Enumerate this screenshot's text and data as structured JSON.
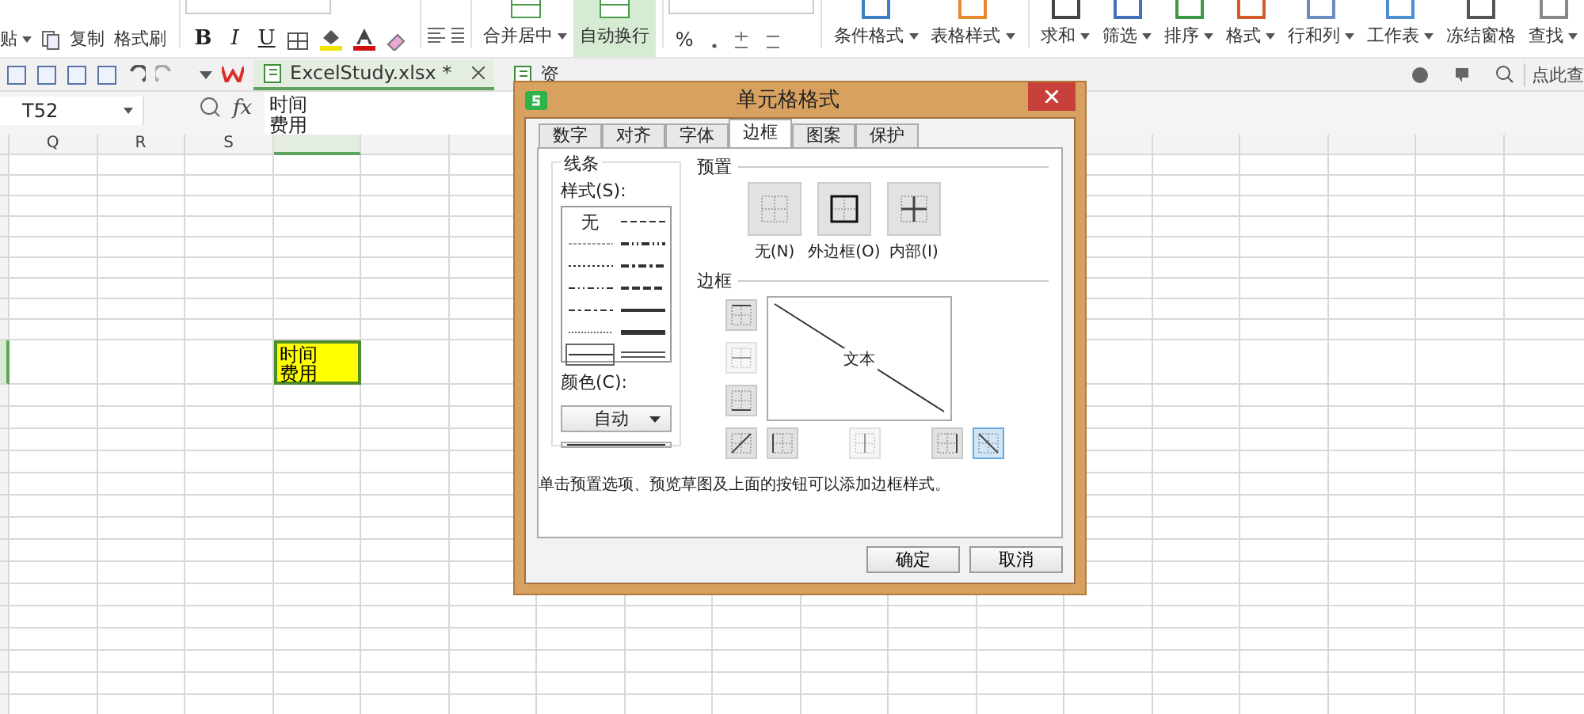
{
  "ribbon": {
    "clipboard": [
      {
        "label": "贴",
        "menu": true
      },
      {
        "label": "复制",
        "menu": false
      },
      {
        "label": "格式刷",
        "menu": false
      }
    ],
    "font_styles": [
      "B",
      "I",
      "U"
    ],
    "alignment": [
      {
        "label": "合并居中",
        "menu": true,
        "on": false
      },
      {
        "label": "自动换行",
        "menu": false,
        "on": true
      }
    ],
    "number": [
      "%"
    ],
    "commands": [
      {
        "label": "条件格式",
        "menu": true
      },
      {
        "label": "表格样式",
        "menu": true
      },
      {
        "label": "求和",
        "menu": true
      },
      {
        "label": "筛选",
        "menu": true
      },
      {
        "label": "排序",
        "menu": true
      },
      {
        "label": "格式",
        "menu": true
      },
      {
        "label": "行和列",
        "menu": true
      },
      {
        "label": "工作表",
        "menu": true
      },
      {
        "label": "冻结窗格",
        "menu": false
      },
      {
        "label": "查找",
        "menu": true
      }
    ]
  },
  "doc_tabs": [
    {
      "label": "ExcelStudy.xlsx *",
      "selected": true
    },
    {
      "label": "资",
      "selected": false
    }
  ],
  "search": {
    "placeholder": "点此查"
  },
  "formula_bar": {
    "cell": "T52",
    "function_label": "fx",
    "lines": [
      "时间",
      "费用"
    ]
  },
  "sheet": {
    "columns": [
      "Q",
      "R",
      "S"
    ],
    "cell": {
      "lines": [
        "时间",
        "费用"
      ]
    }
  },
  "dialog": {
    "title": "单元格格式",
    "tabs": [
      {
        "label": "数字",
        "selected": false
      },
      {
        "label": "对齐",
        "selected": false
      },
      {
        "label": "字体",
        "selected": false
      },
      {
        "label": "边框",
        "selected": true
      },
      {
        "label": "图案",
        "selected": false
      },
      {
        "label": "保护",
        "selected": false
      }
    ],
    "line": {
      "title": "线条",
      "style_label": "样式(S):",
      "color_label": "颜色(C):",
      "color_value": "自动",
      "styles": [
        {
          "kind": "none",
          "label": "无",
          "selected": false
        },
        {
          "kind": "dashed",
          "selected": false
        },
        {
          "kind": "hair-dashed",
          "selected": false
        },
        {
          "kind": "medium-dash-dot-dot",
          "selected": false
        },
        {
          "kind": "dotted",
          "selected": false
        },
        {
          "kind": "medium-dash-dot",
          "selected": false
        },
        {
          "kind": "dash-dot-dot",
          "selected": false
        },
        {
          "kind": "medium-dashed",
          "selected": false
        },
        {
          "kind": "dash-dot",
          "selected": false
        },
        {
          "kind": "medium",
          "selected": false
        },
        {
          "kind": "hair",
          "selected": false
        },
        {
          "kind": "thick",
          "selected": false
        },
        {
          "kind": "thin",
          "selected": true
        },
        {
          "kind": "double",
          "selected": false
        }
      ]
    },
    "presets": {
      "title": "预置",
      "items": [
        {
          "kind": "none",
          "label": "无(N)"
        },
        {
          "kind": "outline",
          "label": "外边框(O)"
        },
        {
          "kind": "inside",
          "label": "内部(I)"
        }
      ]
    },
    "border": {
      "title": "边框",
      "preview_text": "文本",
      "side_buttons": [
        {
          "kind": "top",
          "disabled": false,
          "on": false
        },
        {
          "kind": "middle",
          "disabled": true,
          "on": false
        },
        {
          "kind": "bottom",
          "disabled": false,
          "on": false
        }
      ],
      "bottom_buttons": [
        {
          "kind": "diagonal-up",
          "disabled": false,
          "on": false
        },
        {
          "kind": "left",
          "disabled": false,
          "on": false
        },
        {
          "kind": "center",
          "disabled": true,
          "on": false
        },
        {
          "kind": "right",
          "disabled": false,
          "on": false
        },
        {
          "kind": "diagonal-down",
          "disabled": false,
          "on": true
        }
      ]
    },
    "hint": "单击预置选项、预览草图及上面的按钮可以添加边框样式。",
    "buttons": [
      "确定",
      "取消"
    ]
  }
}
